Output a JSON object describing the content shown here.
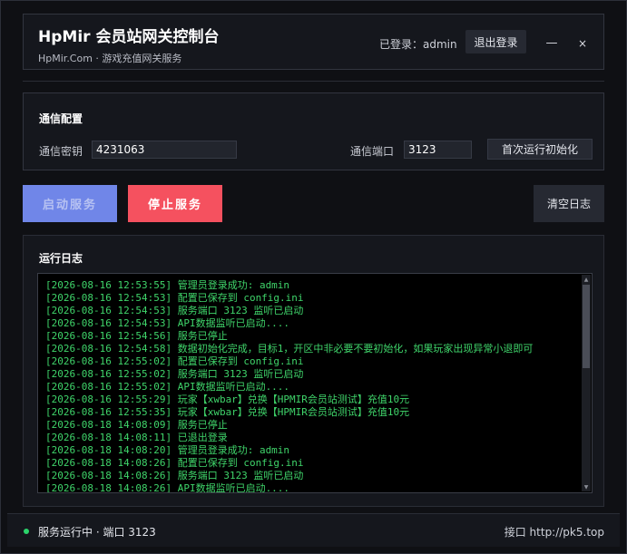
{
  "header": {
    "title": "HpMir 会员站网关控制台",
    "subtitle": "HpMir.Com · 游戏充值网关服务",
    "login_status": "已登录：admin",
    "logout_label": "退出登录",
    "minimize_symbol": "—",
    "close_symbol": "×"
  },
  "config": {
    "section_title": "通信配置",
    "key_label": "通信密钥",
    "key_value": "4231063",
    "port_label": "通信端口",
    "port_value": "3123",
    "init_label": "首次运行初始化"
  },
  "actions": {
    "start_label": "启动服务",
    "stop_label": "停止服务",
    "clear_label": "清空日志"
  },
  "log": {
    "section_title": "运行日志",
    "lines": [
      "[2026-08-16 12:53:55] 管理员登录成功: admin",
      "[2026-08-16 12:54:53] 配置已保存到 config.ini",
      "[2026-08-16 12:54:53] 服务端口 3123 监听已启动",
      "[2026-08-16 12:54:53] API数据监听已启动....",
      "[2026-08-16 12:54:56] 服务已停止",
      "[2026-08-16 12:54:58] 数据初始化完成，目标1，开区中非必要不要初始化，如果玩家出现异常小退即可",
      "[2026-08-16 12:55:02] 配置已保存到 config.ini",
      "[2026-08-16 12:55:02] 服务端口 3123 监听已启动",
      "[2026-08-16 12:55:02] API数据监听已启动....",
      "[2026-08-16 12:55:29] 玩家【xwbar】兑换【HPMIR会员站测试】充值10元",
      "[2026-08-16 12:55:35] 玩家【xwbar】兑换【HPMIR会员站测试】充值10元",
      "[2026-08-18 14:08:09] 服务已停止",
      "[2026-08-18 14:08:11] 已退出登录",
      "[2026-08-18 14:08:20] 管理员登录成功: admin",
      "[2026-08-18 14:08:26] 配置已保存到 config.ini",
      "[2026-08-18 14:08:26] 服务端口 3123 监听已启动",
      "[2026-08-18 14:08:26] API数据监听已启动...."
    ]
  },
  "status_bar": {
    "status_text": "服务运行中 · 端口 3123",
    "api_text": "接口 http://pk5.top",
    "status_color": "#2bd46b"
  },
  "colors": {
    "accent_start": "#7086e8",
    "accent_stop": "#f5515f",
    "log_text": "#3fd46a"
  }
}
